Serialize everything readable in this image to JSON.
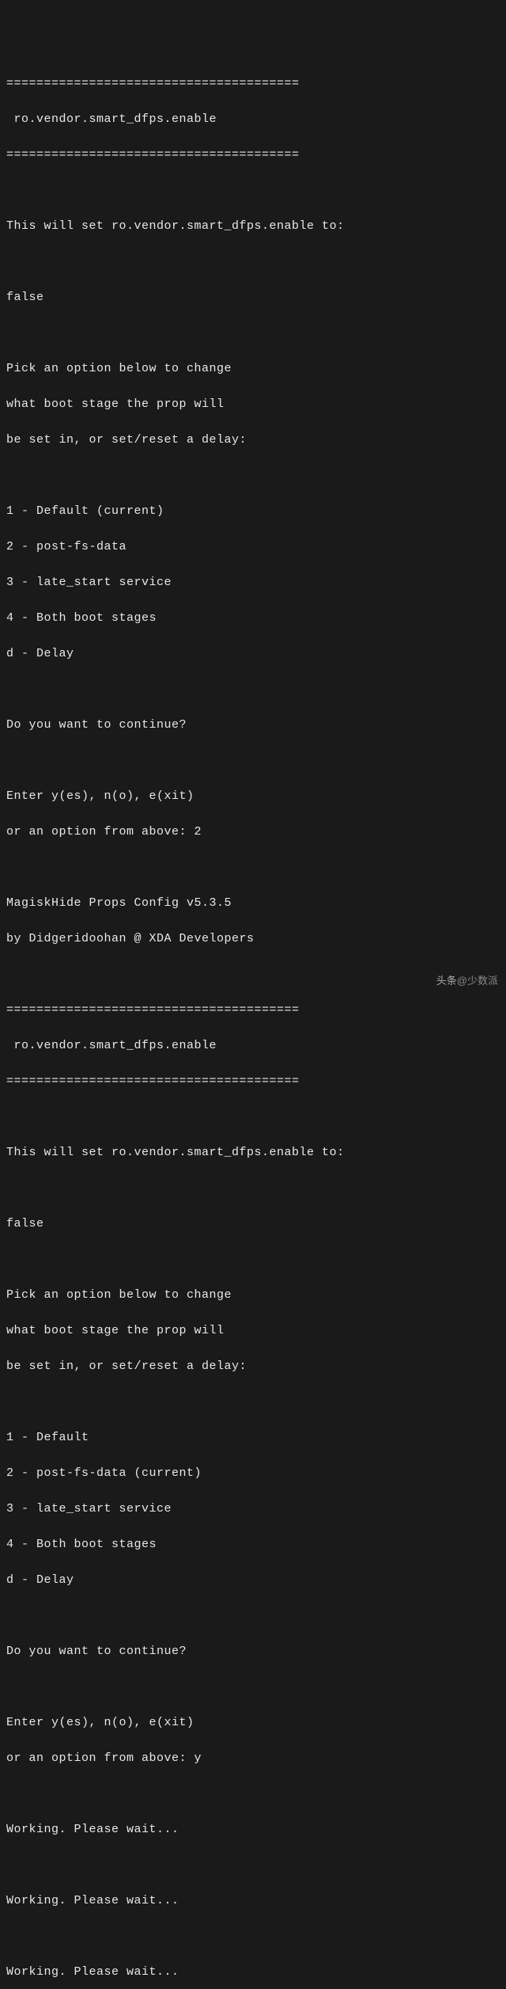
{
  "divider": "=======================================",
  "section1": {
    "title": " ro.vendor.smart_dfps.enable",
    "set_line": "This will set ro.vendor.smart_dfps.enable to:",
    "value": "false",
    "pick_1": "Pick an option below to change",
    "pick_2": "what boot stage the prop will",
    "pick_3": "be set in, or set/reset a delay:",
    "opt_1": "1 - Default (current)",
    "opt_2": "2 - post-fs-data",
    "opt_3": "3 - late_start service",
    "opt_4": "4 - Both boot stages",
    "opt_d": "d - Delay",
    "continue_q": "Do you want to continue?",
    "enter_line": "Enter y(es), n(o), e(xit)",
    "prompt": "or an option from above: 2"
  },
  "app_header": {
    "line1": "MagiskHide Props Config v5.3.5",
    "line2": "by Didgeridoohan @ XDA Developers"
  },
  "section2": {
    "title": " ro.vendor.smart_dfps.enable",
    "set_line": "This will set ro.vendor.smart_dfps.enable to:",
    "value": "false",
    "pick_1": "Pick an option below to change",
    "pick_2": "what boot stage the prop will",
    "pick_3": "be set in, or set/reset a delay:",
    "opt_1": "1 - Default",
    "opt_2": "2 - post-fs-data (current)",
    "opt_3": "3 - late_start service",
    "opt_4": "4 - Both boot stages",
    "opt_d": "d - Delay",
    "continue_q": "Do you want to continue?",
    "enter_line": "Enter y(es), n(o), e(xit)",
    "prompt": "or an option from above: y"
  },
  "working": "Working. Please wait...",
  "watermark": {
    "prefix": "头条",
    "handle": "@少数派"
  }
}
